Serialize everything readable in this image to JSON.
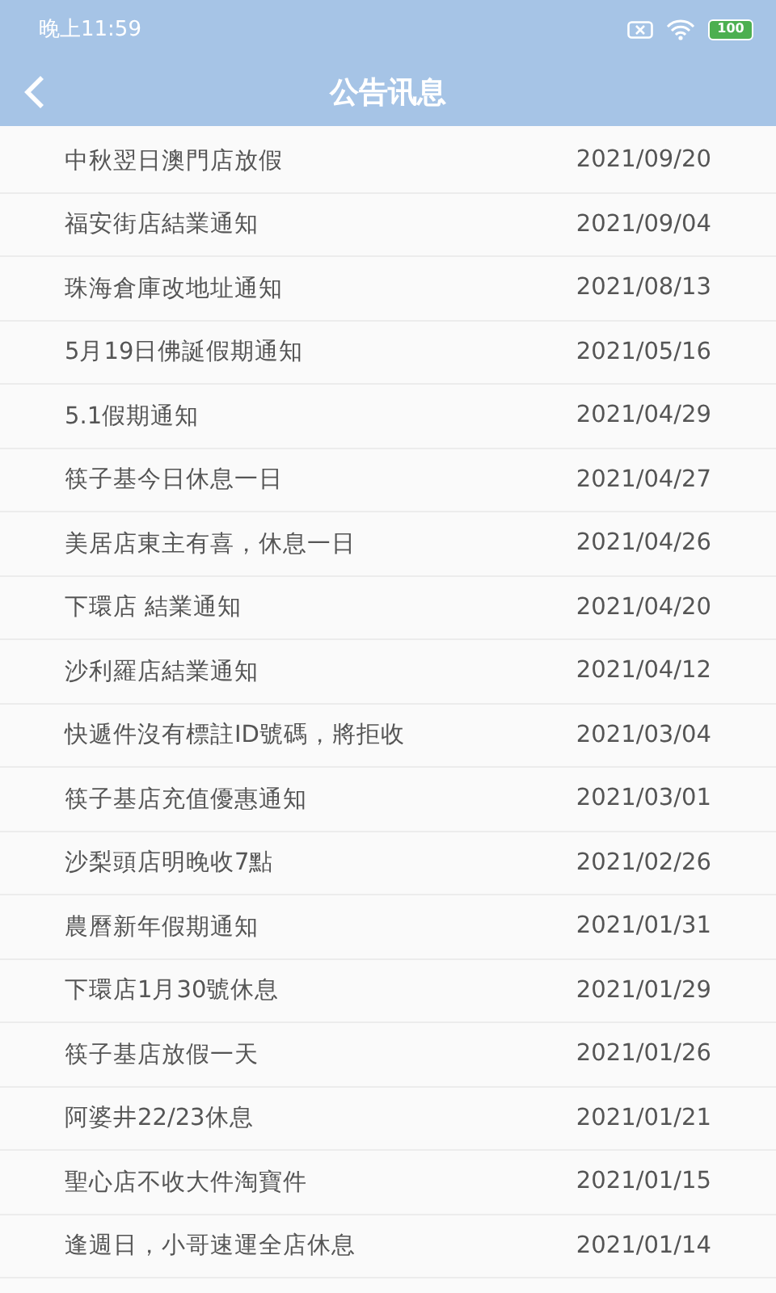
{
  "status_bar": {
    "time": "晚上11:59",
    "battery": "100"
  },
  "header": {
    "title": "公告讯息"
  },
  "notices": [
    {
      "title": "中秋翌日澳門店放假",
      "date": "2021/09/20"
    },
    {
      "title": "福安街店結業通知",
      "date": "2021/09/04"
    },
    {
      "title": "珠海倉庫改地址通知",
      "date": "2021/08/13"
    },
    {
      "title": "5月19日佛誕假期通知",
      "date": "2021/05/16"
    },
    {
      "title": "5.1假期通知",
      "date": "2021/04/29"
    },
    {
      "title": "筷子基今日休息一日",
      "date": "2021/04/27"
    },
    {
      "title": "美居店東主有喜，休息一日",
      "date": "2021/04/26"
    },
    {
      "title": "下環店 結業通知",
      "date": "2021/04/20"
    },
    {
      "title": "沙利羅店結業通知",
      "date": "2021/04/12"
    },
    {
      "title": "快遞件沒有標註ID號碼，將拒收",
      "date": "2021/03/04"
    },
    {
      "title": "筷子基店充值優惠通知",
      "date": "2021/03/01"
    },
    {
      "title": "沙梨頭店明晚收7點",
      "date": "2021/02/26"
    },
    {
      "title": "農曆新年假期通知",
      "date": "2021/01/31"
    },
    {
      "title": "下環店1月30號休息",
      "date": "2021/01/29"
    },
    {
      "title": "筷子基店放假一天",
      "date": "2021/01/26"
    },
    {
      "title": "阿婆井22/23休息",
      "date": "2021/01/21"
    },
    {
      "title": "聖心店不收大件淘寶件",
      "date": "2021/01/15"
    },
    {
      "title": "逢週日，小哥速運全店休息",
      "date": "2021/01/14"
    }
  ]
}
